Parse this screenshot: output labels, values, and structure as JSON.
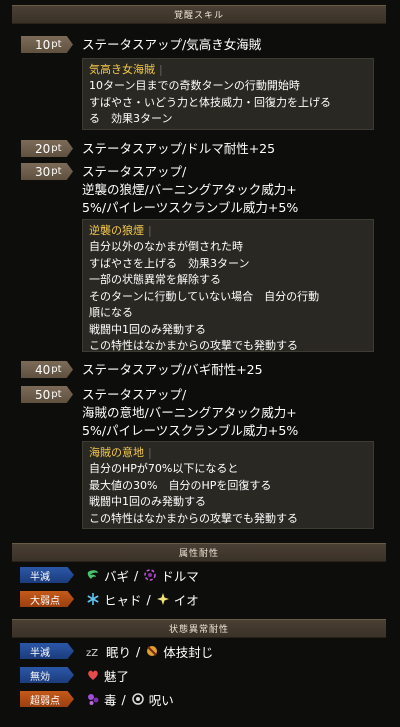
{
  "awakening": {
    "header": "覚醒スキル",
    "skills": [
      {
        "pt": "10",
        "unit": "pt",
        "line1": "ステータスアップ/気高き女海賊"
      },
      {
        "pt": "20",
        "unit": "pt",
        "line1": "ステータスアップ/ドルマ耐性+25"
      },
      {
        "pt": "30",
        "unit": "pt",
        "line1": "ステータスアップ/",
        "line2": "逆襲の狼煙/バーニングアタック威力+",
        "line3": "5%/パイレーツスクランブル威力+5%"
      },
      {
        "pt": "40",
        "unit": "pt",
        "line1": "ステータスアップ/バギ耐性+25"
      },
      {
        "pt": "50",
        "unit": "pt",
        "line1": "ステータスアップ/",
        "line2": "海賊の意地/バーニングアタック威力+",
        "line3": "5%/パイレーツスクランブル威力+5%"
      }
    ],
    "details": [
      {
        "title": "気高き女海賊",
        "lines": [
          "10ターン目までの奇数ターンの行動開始時",
          "すばやさ・いどう力と体技威力・回復力を上げる",
          "る　効果3ターン"
        ]
      },
      {
        "title": "逆襲の狼煙",
        "lines": [
          "自分以外のなかまが倒された時",
          "すばやさを上げる　効果3ターン",
          "一部の状態異常を解除する",
          "そのターンに行動していない場合　自分の行動",
          "順になる",
          "戦闘中1回のみ発動する",
          "この特性はなかまからの攻撃でも発動する"
        ]
      },
      {
        "title": "海賊の意地",
        "lines": [
          "自分のHPが70%以下になると",
          "最大値の30%　自分のHPを回復する",
          "戦闘中1回のみ発動する",
          "この特性はなかまからの攻撃でも発動する"
        ]
      }
    ]
  },
  "elemental": {
    "header": "属性耐性",
    "rows": [
      {
        "badge": "半減",
        "color": "#2b57a8",
        "items": [
          {
            "icon": "bagi-wind-icon",
            "label": "バギ"
          },
          {
            "icon": "dolma-dark-icon",
            "label": "ドルマ"
          }
        ]
      },
      {
        "badge": "大弱点",
        "color": "#c55a1a",
        "items": [
          {
            "icon": "hyado-ice-icon",
            "label": "ヒャド"
          },
          {
            "icon": "io-explosion-icon",
            "label": "イオ"
          }
        ]
      }
    ]
  },
  "status": {
    "header": "状態異常耐性",
    "rows": [
      {
        "badge": "半減",
        "color": "#2b57a8",
        "items": [
          {
            "icon": "sleep-icon",
            "label": "眠り"
          },
          {
            "icon": "skill-seal-icon",
            "label": "体技封じ"
          }
        ]
      },
      {
        "badge": "無効",
        "color": "#2b57a8",
        "items": [
          {
            "icon": "charm-icon",
            "label": "魅了"
          }
        ]
      },
      {
        "badge": "超弱点",
        "color": "#c55a1a",
        "items": [
          {
            "icon": "poison-icon",
            "label": "毒"
          },
          {
            "icon": "curse-icon",
            "label": "呪い"
          }
        ]
      }
    ]
  }
}
